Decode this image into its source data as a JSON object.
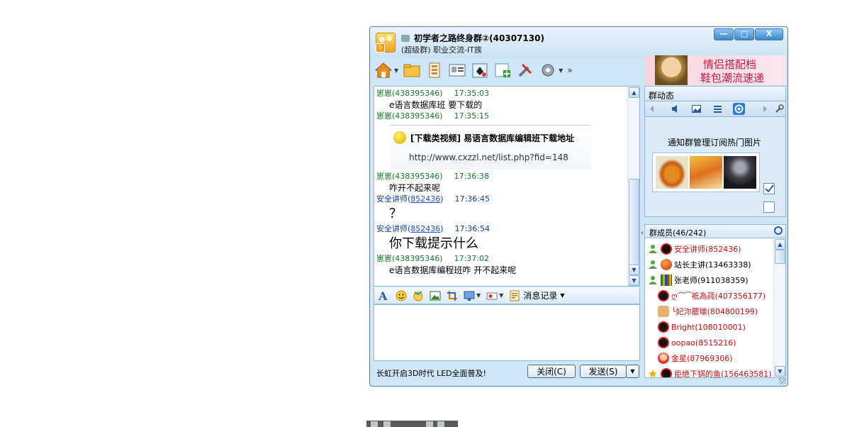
{
  "window": {
    "title": "初学者之路终身群②(40307130)",
    "subtitle": "(超级群) 职业交流-IT族",
    "buttons": {
      "minimize": "—",
      "maximize": "□",
      "close": "X"
    }
  },
  "toolbar": {
    "icons": [
      "home-icon",
      "folder-icon",
      "group-files-icon",
      "business-card-icon",
      "game-icon",
      "add-app-icon",
      "tools-icon",
      "settings-icon"
    ],
    "more": "»"
  },
  "ad": {
    "line1": "情侣搭配档",
    "line2": "鞋包潮流速递"
  },
  "chat": {
    "messages": [
      {
        "sender": "崽崽",
        "qq": "(438395346)",
        "time": "17:35:03",
        "text": "e语言数据库班  要下载的"
      },
      {
        "sender": "崽崽",
        "qq": "(438395346)",
        "time": "17:35:15",
        "text": ""
      },
      {
        "sender": "崽崽",
        "qq": "(438395346)",
        "time": "17:36:38",
        "text": "咋开不起来呢"
      },
      {
        "sender": "安全讲师",
        "qq": "852436",
        "time": "17:36:45",
        "text": "？"
      },
      {
        "sender": "安全讲师",
        "qq": "852436",
        "time": "17:36:54",
        "text": "你下载提示什么"
      },
      {
        "sender": "崽崽",
        "qq": "(438395346)",
        "time": "17:37:02",
        "text": "e语言数据库编程班咋  开不起来呢"
      }
    ],
    "card": {
      "title": "[下载类视频] 易语言数据库编辑班下载地址",
      "url": "http://www.cxzzl.net/list.php?fid=148"
    }
  },
  "format_bar": {
    "icons": [
      "font-icon",
      "emoticon-icon",
      "magic-face-icon",
      "picture-icon",
      "screenshot-icon",
      "screen-share-icon",
      "audio-video-icon",
      "history-icon"
    ],
    "history_label": "消息记录"
  },
  "footer": {
    "ticker": "长虹开启3D时代 LED全面普及!",
    "close_label": "关闭(C)",
    "send_label": "发送(S)"
  },
  "group_news": {
    "title": "群动态",
    "notice": "通知群管理订阅热门图片"
  },
  "members": {
    "header": "群成员(46/242)",
    "list": [
      {
        "name": "安全讲师(852436)",
        "role": "admin",
        "avatar_color": "#d62020"
      },
      {
        "name": "站长主讲(13463338)",
        "role": "admin",
        "avatar_color": "#e05a10",
        "dark": true
      },
      {
        "name": "张老师(911038359)",
        "role": "admin",
        "avatar_color": "#2a7a2a",
        "dark": true
      },
      {
        "name": "ღ⌒⁀祗為莼(407356177)",
        "role": "",
        "avatar_color": "#d62020"
      },
      {
        "name": "╰妃沵罷壊(804800199)",
        "role": "",
        "avatar_color": "#e8a060"
      },
      {
        "name": "Bright(108010001)",
        "role": "",
        "avatar_color": "#d62020"
      },
      {
        "name": "oopao(8515216)",
        "role": "",
        "avatar_color": "#d62020"
      },
      {
        "name": "金星(87969306)",
        "role": "",
        "avatar_color": "#e03030"
      },
      {
        "name": "拒绝下锅的鱼(156463581)",
        "role": "star",
        "avatar_color": "#d62020"
      }
    ]
  },
  "colors": {
    "window_border": "#4b84c6",
    "member_red": "#cc1010",
    "sender_green": "#127a2b"
  }
}
